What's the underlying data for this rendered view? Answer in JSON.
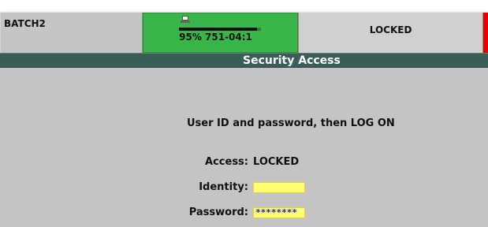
{
  "header": {
    "batch_label": "BATCH2",
    "status_text": "95% 751-04:1",
    "progress_percent": 95,
    "lock_state": "LOCKED"
  },
  "colors": {
    "status_green": "#39b54a",
    "title_bar": "#3b5d58",
    "alert_red": "#e00000",
    "input_yellow": "#ffff72",
    "password_text": "#1b1bd4"
  },
  "security_panel": {
    "title": "Security Access",
    "instruction": "User ID and password, then LOG ON",
    "access_label": "Access:",
    "access_value": "LOCKED",
    "identity_label": "Identity:",
    "identity_value": "",
    "password_label": "Password:",
    "password_value": "********"
  },
  "icons": {
    "status_icon": "computer-icon"
  }
}
